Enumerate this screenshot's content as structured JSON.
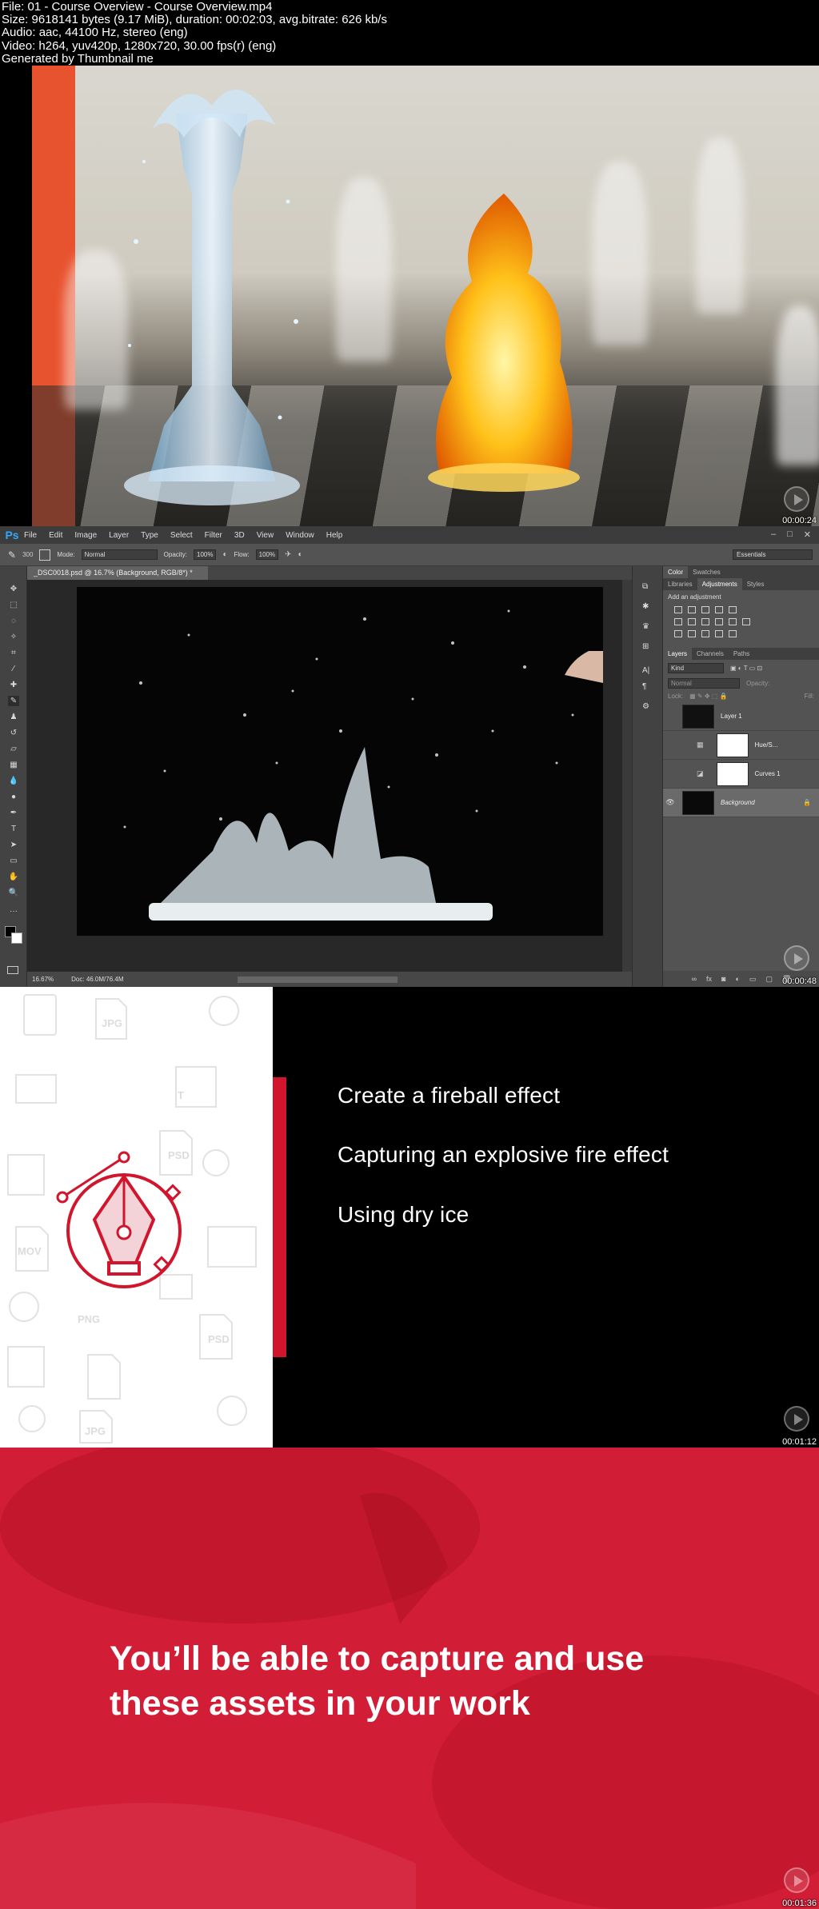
{
  "header": {
    "lines": [
      "File: 01 - Course Overview - Course Overview.mp4",
      "Size: 9618141 bytes (9.17 MiB), duration: 00:02:03, avg.bitrate: 626 kb/s",
      "Audio: aac, 44100 Hz, stereo (eng)",
      "Video: h264, yuv420p, 1280x720, 30.00 fps(r) (eng)",
      "Generated by Thumbnail me"
    ]
  },
  "frames": [
    {
      "timestamp": "00:00:24"
    },
    {
      "timestamp": "00:00:48"
    },
    {
      "timestamp": "00:01:12"
    },
    {
      "timestamp": "00:01:36"
    }
  ],
  "photoshop": {
    "logo": "Ps",
    "menu": [
      "File",
      "Edit",
      "Image",
      "Layer",
      "Type",
      "Select",
      "Filter",
      "3D",
      "View",
      "Window",
      "Help"
    ],
    "options": {
      "brush_size": "300",
      "mode_label": "Mode:",
      "mode_value": "Normal",
      "opacity_label": "Opacity:",
      "opacity_value": "100%",
      "flow_label": "Flow:",
      "flow_value": "100%"
    },
    "workspace": "Essentials",
    "doc_tab": "_DSC0018.psd @ 16.7% (Background, RGB/8*) *",
    "status": {
      "zoom": "16.67%",
      "doc": "Doc: 46.0M/76.4M"
    },
    "color_tabs": [
      "Color",
      "Swatches"
    ],
    "adjust_tabs": [
      "Libraries",
      "Adjustments",
      "Styles"
    ],
    "adjust_title": "Add an adjustment",
    "layers_tabs": [
      "Layers",
      "Channels",
      "Paths"
    ],
    "layers_kind": "Kind",
    "layers_blend": "Normal",
    "layers_opacity": "Opacity:",
    "layers_lock": "Lock:",
    "layers_fill": "Fill:",
    "layers": [
      {
        "name": "Layer 1"
      },
      {
        "name": "Hue/S..."
      },
      {
        "name": "Curves 1"
      },
      {
        "name": "Background"
      }
    ]
  },
  "topics": [
    "Create a fireball effect",
    "Capturing an explosive fire effect",
    "Using dry ice"
  ],
  "statement": {
    "line1": "You’ll be able to capture and use",
    "line2": "these assets in your work"
  },
  "colors": {
    "accent_red": "#d0152c",
    "ps_blue": "#31a8ff",
    "orange": "#e8532f"
  }
}
